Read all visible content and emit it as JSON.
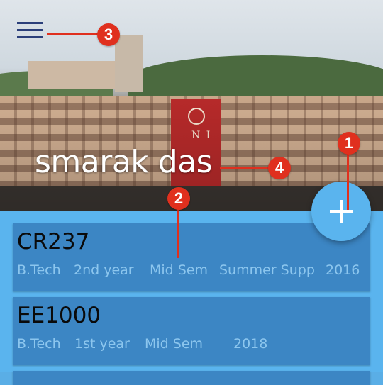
{
  "header": {
    "user_name": "smarak das",
    "banner_letters": "N I"
  },
  "courses": [
    {
      "code": "CR237",
      "degree": "B.Tech",
      "year": "2nd year",
      "exam": "Mid Sem",
      "session": "Summer Supp",
      "exam_year": "2016"
    },
    {
      "code": "EE1000",
      "degree": "B.Tech",
      "year": "1st year",
      "exam": "Mid Sem",
      "session": "",
      "exam_year": "2018"
    }
  ],
  "annotations": {
    "a1": "1",
    "a2": "2",
    "a3": "3",
    "a4": "4"
  },
  "icons": {
    "menu": "hamburger-menu-icon",
    "add": "plus-icon"
  },
  "colors": {
    "accent": "#5ab4ee",
    "card": "#3c86c4",
    "callout": "#e0301e"
  }
}
